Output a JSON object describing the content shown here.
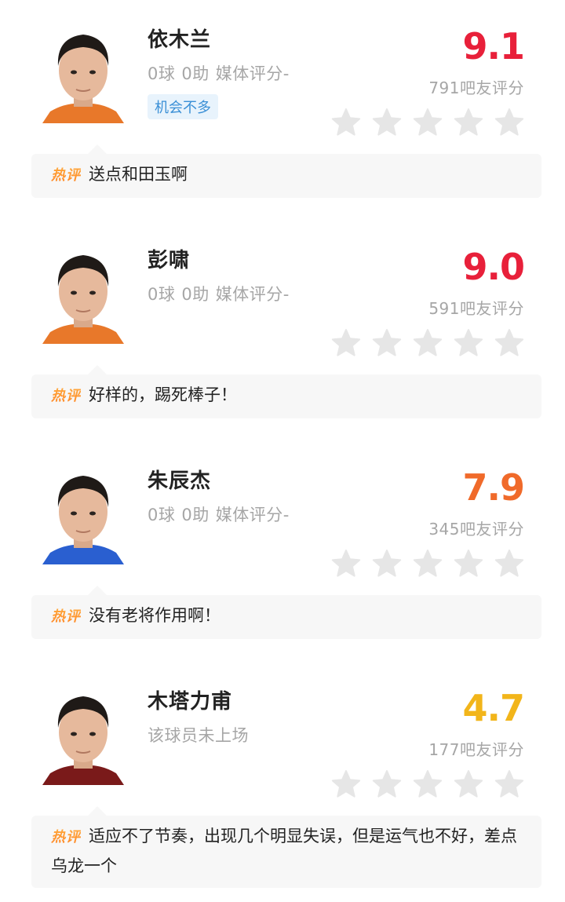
{
  "players": [
    {
      "name": "依木兰",
      "goals": "0球",
      "assists": "0助",
      "media_rating": "媒体评分-",
      "tag": "机会不多",
      "score": "9.1",
      "score_color": "#e8203a",
      "votes": "791吧友评分",
      "stars_filled": 0,
      "jersey_color": "#e8782a",
      "comment_badge": "热评",
      "comment": "送点和田玉啊"
    },
    {
      "name": "彭啸",
      "goals": "0球",
      "assists": "0助",
      "media_rating": "媒体评分-",
      "score": "9.0",
      "score_color": "#e8203a",
      "votes": "591吧友评分",
      "stars_filled": 0,
      "jersey_color": "#e8782a",
      "comment_badge": "热评",
      "comment": "好样的，踢死棒子！"
    },
    {
      "name": "朱辰杰",
      "goals": "0球",
      "assists": "0助",
      "media_rating": "媒体评分-",
      "score": "7.9",
      "score_color": "#f06a2a",
      "votes": "345吧友评分",
      "stars_filled": 0,
      "jersey_color": "#2a5fd0",
      "comment_badge": "热评",
      "comment": "没有老将作用啊！"
    },
    {
      "name": "木塔力甫",
      "status": "该球员未上场",
      "score": "4.7",
      "score_color": "#f2b51a",
      "votes": "177吧友评分",
      "stars_filled": 0,
      "jersey_color": "#7a1a1a",
      "comment_badge": "热评",
      "comment": "适应不了节奏，出现几个明显失误，但是运气也不好，差点乌龙一个"
    }
  ]
}
